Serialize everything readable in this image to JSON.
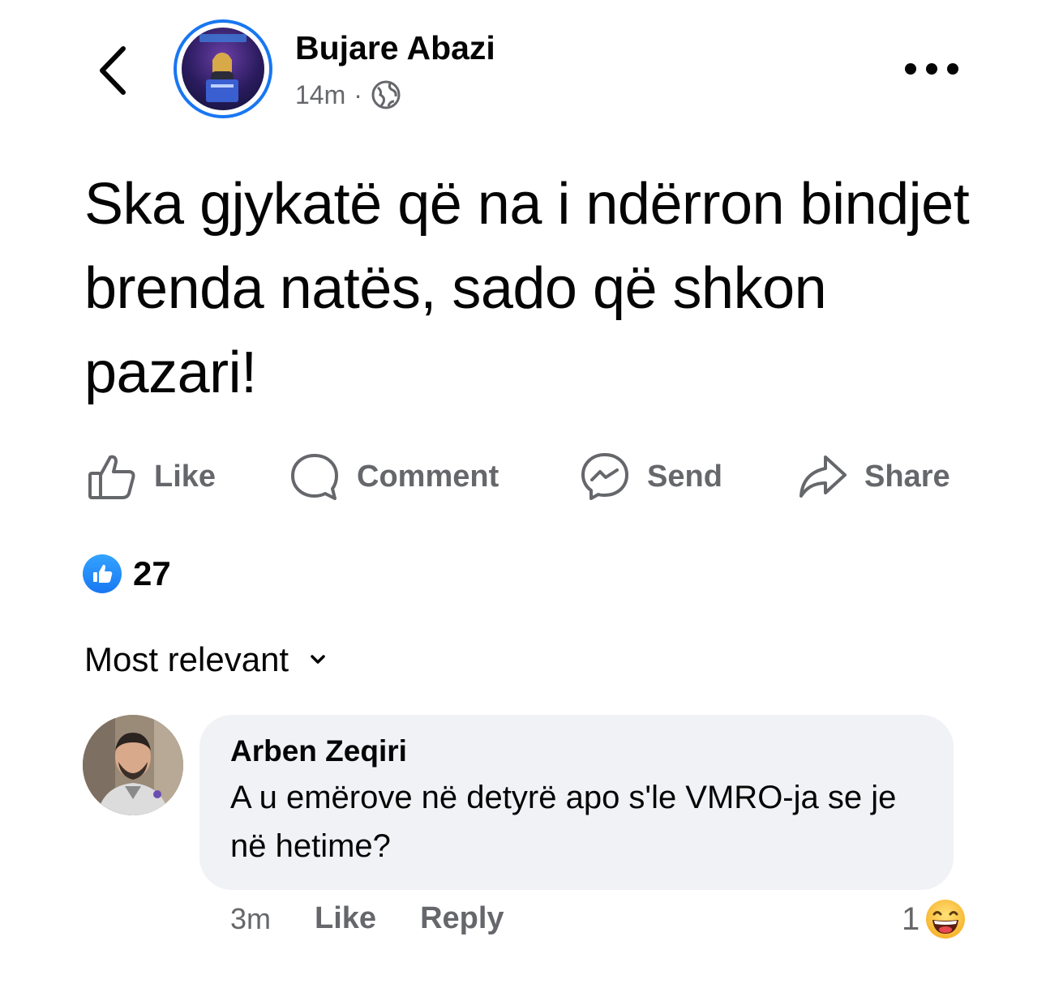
{
  "header": {
    "author_name": "Bujare Abazi",
    "timestamp": "14m",
    "separator": "·",
    "privacy_icon": "globe-icon",
    "back_icon": "chevron-left-icon",
    "more_icon": "more-horizontal-icon"
  },
  "post": {
    "text": "Ska gjykatë që na i ndërron bindjet brenda natës, sado që shkon pazari!"
  },
  "actions": [
    {
      "label": "Like",
      "icon": "thumbs-up-icon"
    },
    {
      "label": "Comment",
      "icon": "comment-icon"
    },
    {
      "label": "Send",
      "icon": "messenger-icon"
    },
    {
      "label": "Share",
      "icon": "share-icon"
    }
  ],
  "reactions": {
    "count": "27",
    "icon": "like-reaction-icon"
  },
  "comments_sort": {
    "label": "Most relevant",
    "icon": "chevron-down-icon"
  },
  "comment": {
    "author": "Arben Zeqiri",
    "text": "A u emërove në detyrë apo s'le VMRO-ja se je në hetime?",
    "time": "3m",
    "like_label": "Like",
    "reply_label": "Reply",
    "reaction_count": "1",
    "reaction_icon": "laughing-emoji-icon"
  },
  "colors": {
    "accent": "#1877f2",
    "secondary_text": "#65676b",
    "bubble_bg": "#f0f2f5",
    "primary_text": "#050505"
  }
}
